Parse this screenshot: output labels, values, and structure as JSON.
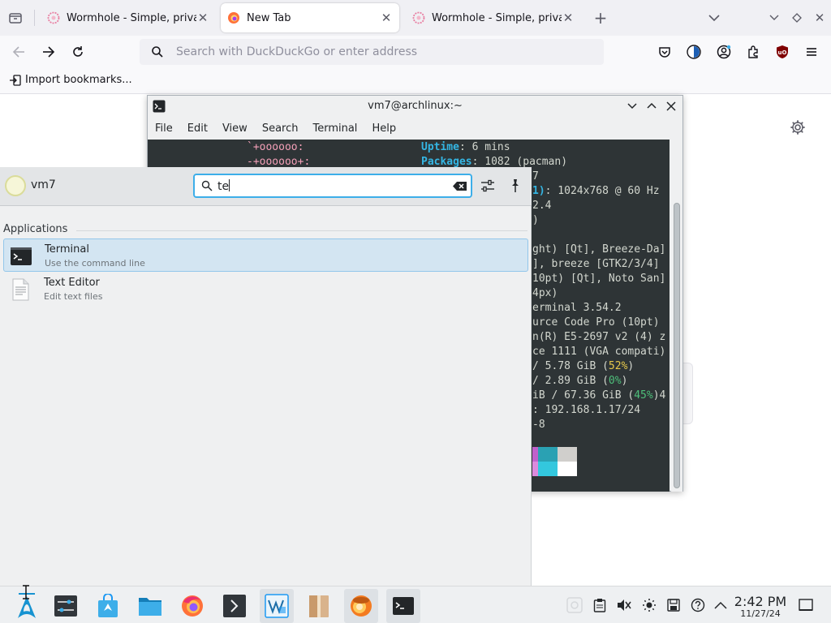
{
  "browser": {
    "tabs": [
      {
        "title": "Wormhole - Simple, privat",
        "active": false
      },
      {
        "title": "New Tab",
        "active": true
      },
      {
        "title": "Wormhole - Simple, privat",
        "active": false
      }
    ],
    "address_placeholder": "Search with DuckDuckGo or enter address",
    "bookmarks_import_label": "Import bookmarks..."
  },
  "terminal": {
    "title": "vm7@archlinux:~",
    "menu": [
      "File",
      "Edit",
      "View",
      "Search",
      "Terminal",
      "Help"
    ],
    "art": [
      "`+oooooo:",
      "-+oooooo+:"
    ],
    "info": {
      "uptime_label": "Uptime",
      "uptime_value": "6 mins",
      "packages_label": "Packages",
      "packages_value": "1082 (pacman)"
    },
    "fragments": {
      "l3": "7",
      "l4a": "1)",
      "l4b": ": 1024x768 @ 60 Hz",
      "l5": "2.4",
      "l6": ")",
      "l8": "ght) [Qt], Breeze-Da]",
      "l9": "], breeze [GTK2/3/4]",
      "l10": "10pt) [Qt], Noto San]",
      "l11": "4px)",
      "l12": "erminal 3.54.2",
      "l13": "urce Code Pro (10pt)",
      "l14": "n(R) E5-2697 v2 (4) z",
      "l15": "ce 1111 (VGA compati)",
      "l16a": "/ 5.78 GiB (",
      "l16b": "52%",
      "l16c": ")",
      "l17a": "/ 2.89 GiB (",
      "l17b": "0%",
      "l17c": ")",
      "l18a": "iB / 67.36 GiB (",
      "l18b": "45%",
      "l18c": ")4",
      "l19": ": 192.168.1.17/24",
      "l20": "-8"
    }
  },
  "launcher": {
    "username": "vm7",
    "search_value": "te",
    "section_title": "Applications",
    "apps": [
      {
        "name": "Terminal",
        "description": "Use the command line",
        "selected": true
      },
      {
        "name": "Text Editor",
        "description": "Edit text files",
        "selected": false
      }
    ]
  },
  "taskbar": {
    "time": "2:42 PM",
    "date": "11/27/24"
  },
  "colors": {
    "accent": "#3daee9",
    "terminal_bg": "#2e3436",
    "terminal_label": "#34b6e4"
  },
  "icons": [
    "tab-list-icon",
    "wormhole-favicon",
    "firefox-favicon",
    "new-tab-icon",
    "list-all-tabs-icon",
    "back-icon",
    "forward-icon",
    "reload-icon",
    "search-icon",
    "pocket-icon",
    "dark-reader-icon",
    "account-icon",
    "extensions-icon",
    "ublock-icon",
    "menu-icon",
    "import-icon",
    "gear-icon",
    "terminal-icon",
    "minimize-icon",
    "maximize-icon",
    "close-icon",
    "clear-icon",
    "filter-icon",
    "pin-icon",
    "app-launcher-icon",
    "system-settings-icon",
    "discover-icon",
    "file-manager-icon",
    "firefox-icon",
    "konsole-icon",
    "vmware-icon",
    "archive-icon",
    "chromium-like-icon",
    "terminal-task-icon",
    "clipboard-icon",
    "mute-icon",
    "brightness-icon",
    "disk-icon",
    "help-icon",
    "tray-expand-icon",
    "show-desktop-icon"
  ]
}
